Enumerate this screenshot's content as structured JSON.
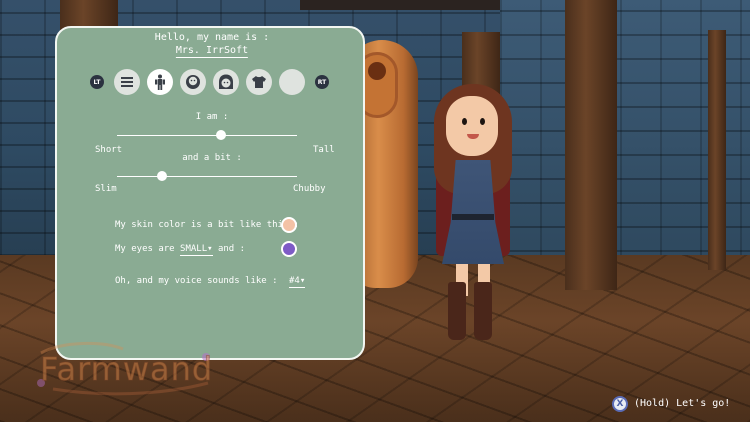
{
  "header": {
    "greeting": "Hello, my name is :",
    "name": "Mrs. IrrSoft"
  },
  "tabs": {
    "left_trigger": "LT",
    "right_trigger": "RT",
    "items": [
      {
        "icon": "menu-lines-icon"
      },
      {
        "icon": "body-icon",
        "active": true
      },
      {
        "icon": "beard-face-icon"
      },
      {
        "icon": "hair-face-icon"
      },
      {
        "icon": "shirt-icon"
      },
      {
        "icon": "blank-icon"
      }
    ]
  },
  "height": {
    "label": "I am :",
    "min_label": "Short",
    "max_label": "Tall",
    "value": 0.58
  },
  "build": {
    "label": "and a bit :",
    "min_label": "Slim",
    "max_label": "Chubby",
    "value": 0.25
  },
  "skin": {
    "label": "My skin color is a bit like this :",
    "color": "#f4c2a6"
  },
  "eyes": {
    "prefix": "My eyes are",
    "size": "SMALL",
    "suffix": "and :",
    "color": "#7e5bc6"
  },
  "voice": {
    "label": "Oh, and my voice sounds like :",
    "value": "#4"
  },
  "logo": {
    "text": "Farmwand"
  },
  "hint": {
    "button": "X",
    "text": "(Hold) Let's go!"
  },
  "colors": {
    "panel": "#8aab93",
    "panel_border": "#f3f7f2"
  }
}
